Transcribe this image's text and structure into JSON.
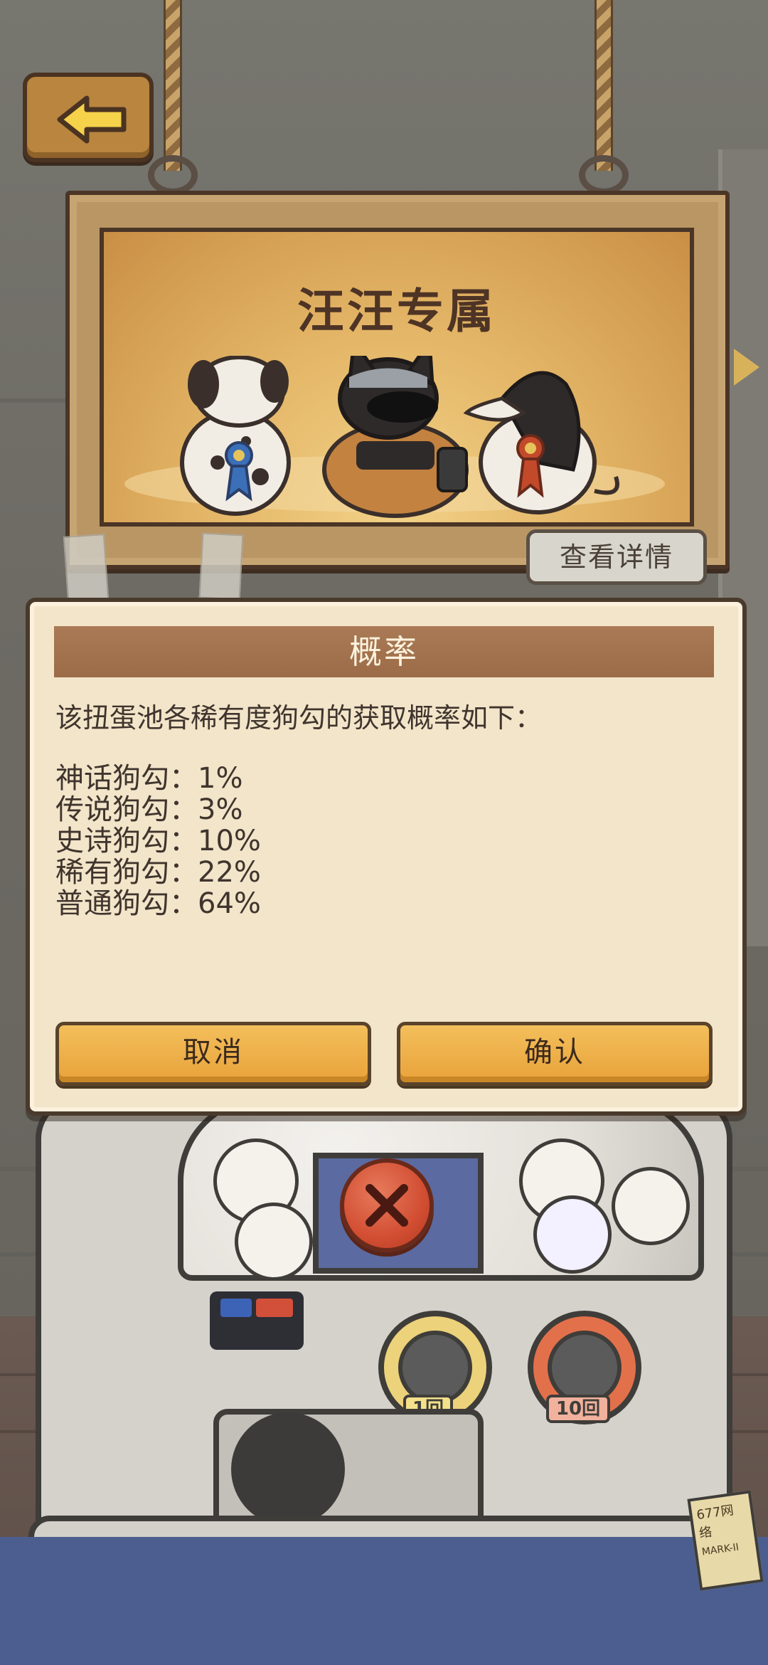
{
  "sign": {
    "title": "汪汪专属",
    "details_label": "查看详情"
  },
  "dialog": {
    "title": "概率",
    "intro": "该扭蛋池各稀有度狗勾的获取概率如下：",
    "rates": [
      {
        "label": "神话狗勾：",
        "value": "1%"
      },
      {
        "label": "传说狗勾：",
        "value": "3%"
      },
      {
        "label": "史诗狗勾：",
        "value": "10%"
      },
      {
        "label": "稀有狗勾：",
        "value": "22%"
      },
      {
        "label": "普通狗勾：",
        "value": "64%"
      }
    ],
    "cancel_label": "取消",
    "confirm_label": "确认"
  },
  "machine": {
    "knob_single": "1回",
    "knob_ten": "10回",
    "brand": "677网络",
    "model": "MARK-II"
  },
  "colors": {
    "dialog_bg": "#f3e5c9",
    "header": "#a07050",
    "button": "#eaa53d",
    "close": "#d24e33"
  }
}
